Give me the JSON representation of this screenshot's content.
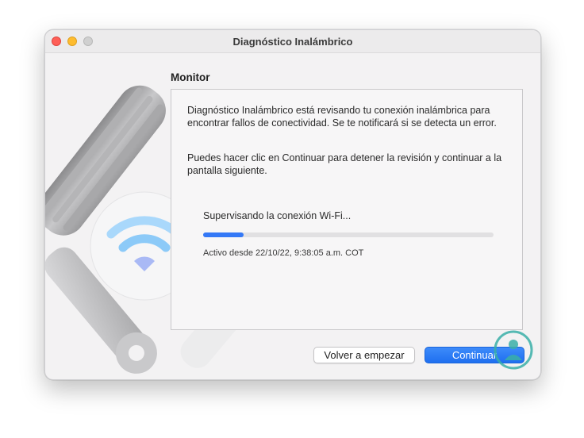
{
  "window": {
    "title": "Diagnóstico Inalámbrico"
  },
  "content": {
    "section_title": "Monitor",
    "paragraph_1": "Diagnóstico Inalámbrico está revisando tu conexión inalámbrica para encontrar fallos de conectividad. Se te notificará si se detecta un error.",
    "paragraph_2": "Puedes hacer clic en Continuar para detener la revisión y continuar a la pantalla siguiente.",
    "status_text": "Supervisando la conexión Wi-Fi...",
    "progress_percent": 14,
    "active_since": "Activo desde 22/10/22, 9:38:05 a.m. COT"
  },
  "buttons": {
    "restart_label": "Volver a empezar",
    "continue_label": "Continuar"
  },
  "colors": {
    "accent": "#3478f6",
    "wifi_icon": "#7fc3f7"
  },
  "icons": [
    "wrench-icon",
    "wifi-icon",
    "close-icon",
    "minimize-icon",
    "zoom-icon",
    "watermark-logo-icon"
  ]
}
